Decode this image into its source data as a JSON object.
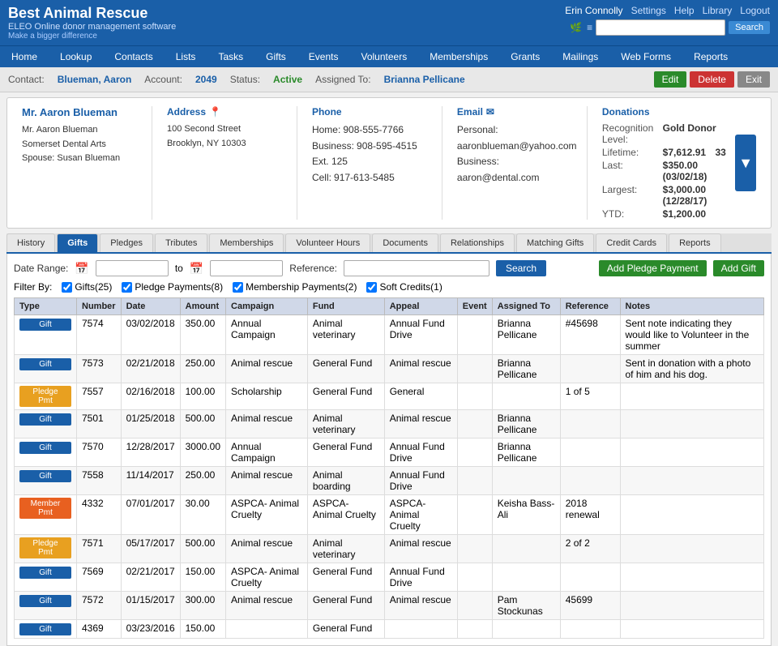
{
  "app": {
    "title": "Best Animal Rescue",
    "subtitle": "ELEO Online donor management software",
    "tagline": "Make a bigger difference"
  },
  "header": {
    "user": "Erin Connolly",
    "nav_links": [
      "Settings",
      "Help",
      "Library",
      "Logout"
    ],
    "search_placeholder": ""
  },
  "main_nav": [
    "Home",
    "Lookup",
    "Contacts",
    "Lists",
    "Tasks",
    "Gifts",
    "Events",
    "Volunteers",
    "Memberships",
    "Grants",
    "Mailings",
    "Web Forms",
    "Reports"
  ],
  "contact_bar": {
    "contact_label": "Contact:",
    "contact_name": "Blueman, Aaron",
    "account_label": "Account:",
    "account_number": "2049",
    "status_label": "Status:",
    "status_value": "Active",
    "assigned_label": "Assigned To:",
    "assigned_name": "Brianna Pellicane",
    "btn_edit": "Edit",
    "btn_delete": "Delete",
    "btn_exit": "Exit"
  },
  "contact_info": {
    "name": "Mr. Aaron Blueman",
    "org": "Somerset Dental Arts",
    "spouse": "Spouse: Susan Blueman",
    "address_title": "Address",
    "street": "100 Second Street",
    "city_state": "Brooklyn, NY 10303",
    "phone_title": "Phone",
    "home_label": "Home:",
    "home_phone": "908-555-7766",
    "business_label": "Business:",
    "business_phone": "908-595-4515 Ext. 125",
    "cell_label": "Cell:",
    "cell_phone": "917-613-5485",
    "email_title": "Email",
    "personal_label": "Personal:",
    "personal_email": "aaronblueman@yahoo.com",
    "business_email_label": "Business:",
    "business_email": "aaron@dental.com",
    "donations_title": "Donations",
    "recognition_label": "Recognition Level:",
    "recognition_value": "Gold Donor",
    "lifetime_label": "Lifetime:",
    "lifetime_value": "$7,612.91",
    "lifetime_count": "33",
    "last_label": "Last:",
    "last_value": "$350.00 (03/02/18)",
    "largest_label": "Largest:",
    "largest_value": "$3,000.00 (12/28/17)",
    "ytd_label": "YTD:",
    "ytd_value": "$1,200.00"
  },
  "sub_tabs": [
    "History",
    "Gifts",
    "Pledges",
    "Tributes",
    "Memberships",
    "Volunteer Hours",
    "Documents",
    "Relationships",
    "Matching Gifts",
    "Credit Cards",
    "Reports"
  ],
  "active_tab": "Gifts",
  "gifts_filter": {
    "date_range_label": "Date Range:",
    "to_label": "to",
    "reference_label": "Reference:",
    "btn_search": "Search",
    "btn_add_pledge": "Add Pledge Payment",
    "btn_add_gift": "Add Gift"
  },
  "checkboxes": [
    {
      "label": "Gifts(25)",
      "checked": true
    },
    {
      "label": "Pledge Payments(8)",
      "checked": true
    },
    {
      "label": "Membership Payments(2)",
      "checked": true
    },
    {
      "label": "Soft Credits(1)",
      "checked": true
    }
  ],
  "filter_by_label": "Filter By:",
  "table_headers": [
    "Type",
    "Number",
    "Date",
    "Amount",
    "Campaign",
    "Fund",
    "Appeal",
    "Event",
    "Assigned To",
    "Reference",
    "Notes"
  ],
  "table_rows": [
    {
      "type": "Gift",
      "type_class": "btn-gift",
      "number": "7574",
      "date": "03/02/2018",
      "amount": "350.00",
      "campaign": "Annual Campaign",
      "fund": "Animal veterinary",
      "appeal": "Annual Fund Drive",
      "event": "",
      "assigned_to": "Brianna Pellicane",
      "reference": "#45698",
      "notes": "Sent note indicating they would like to Volunteer in the summer"
    },
    {
      "type": "Gift",
      "type_class": "btn-gift",
      "number": "7573",
      "date": "02/21/2018",
      "amount": "250.00",
      "campaign": "Animal rescue",
      "fund": "General Fund",
      "appeal": "Animal rescue",
      "event": "",
      "assigned_to": "Brianna Pellicane",
      "reference": "",
      "notes": "Sent in donation with a photo of him and his dog."
    },
    {
      "type": "Pledge Pmt",
      "type_class": "btn-pledge",
      "number": "7557",
      "date": "02/16/2018",
      "amount": "100.00",
      "campaign": "Scholarship",
      "fund": "General Fund",
      "appeal": "General",
      "event": "",
      "assigned_to": "",
      "reference": "1 of 5",
      "notes": ""
    },
    {
      "type": "Gift",
      "type_class": "btn-gift",
      "number": "7501",
      "date": "01/25/2018",
      "amount": "500.00",
      "campaign": "Animal rescue",
      "fund": "Animal veterinary",
      "appeal": "Animal rescue",
      "event": "",
      "assigned_to": "Brianna Pellicane",
      "reference": "",
      "notes": ""
    },
    {
      "type": "Gift",
      "type_class": "btn-gift",
      "number": "7570",
      "date": "12/28/2017",
      "amount": "3000.00",
      "campaign": "Annual Campaign",
      "fund": "General Fund",
      "appeal": "Annual Fund Drive",
      "event": "",
      "assigned_to": "Brianna Pellicane",
      "reference": "",
      "notes": ""
    },
    {
      "type": "Gift",
      "type_class": "btn-gift",
      "number": "7558",
      "date": "11/14/2017",
      "amount": "250.00",
      "campaign": "Animal rescue",
      "fund": "Animal boarding",
      "appeal": "Annual Fund Drive",
      "event": "",
      "assigned_to": "",
      "reference": "",
      "notes": ""
    },
    {
      "type": "Member Pmt",
      "type_class": "btn-member",
      "number": "4332",
      "date": "07/01/2017",
      "amount": "30.00",
      "campaign": "ASPCA- Animal Cruelty",
      "fund": "ASPCA- Animal Cruelty",
      "appeal": "ASPCA- Animal Cruelty",
      "event": "",
      "assigned_to": "Keisha Bass-Ali",
      "reference": "2018 renewal",
      "notes": ""
    },
    {
      "type": "Pledge Pmt",
      "type_class": "btn-pledge",
      "number": "7571",
      "date": "05/17/2017",
      "amount": "500.00",
      "campaign": "Animal rescue",
      "fund": "Animal veterinary",
      "appeal": "Animal rescue",
      "event": "",
      "assigned_to": "",
      "reference": "2 of 2",
      "notes": ""
    },
    {
      "type": "Gift",
      "type_class": "btn-gift",
      "number": "7569",
      "date": "02/21/2017",
      "amount": "150.00",
      "campaign": "ASPCA- Animal Cruelty",
      "fund": "General Fund",
      "appeal": "Annual Fund Drive",
      "event": "",
      "assigned_to": "",
      "reference": "",
      "notes": ""
    },
    {
      "type": "Gift",
      "type_class": "btn-gift",
      "number": "7572",
      "date": "01/15/2017",
      "amount": "300.00",
      "campaign": "Animal rescue",
      "fund": "General Fund",
      "appeal": "Animal rescue",
      "event": "",
      "assigned_to": "Pam Stockunas",
      "reference": "45699",
      "notes": ""
    },
    {
      "type": "Gift",
      "type_class": "btn-gift",
      "number": "4369",
      "date": "03/23/2016",
      "amount": "150.00",
      "campaign": "",
      "fund": "General Fund",
      "appeal": "",
      "event": "",
      "assigned_to": "",
      "reference": "",
      "notes": ""
    }
  ]
}
